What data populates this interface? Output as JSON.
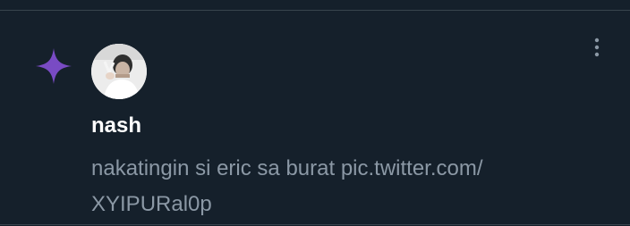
{
  "notification": {
    "type_icon": "sparkle-icon",
    "author": {
      "display_name": "nash",
      "avatar": "profile-photo"
    },
    "tweet_text": "nakatingin si eric sa burat pic.twitter.com/ XYIPURal0p",
    "more_icon": "more-vertical-icon"
  },
  "colors": {
    "background": "#15202b",
    "divider": "#38444d",
    "sparkle": "#794bc4",
    "name": "#ffffff",
    "body_text": "#8b98a5",
    "muted_icon": "#8b98a5"
  }
}
